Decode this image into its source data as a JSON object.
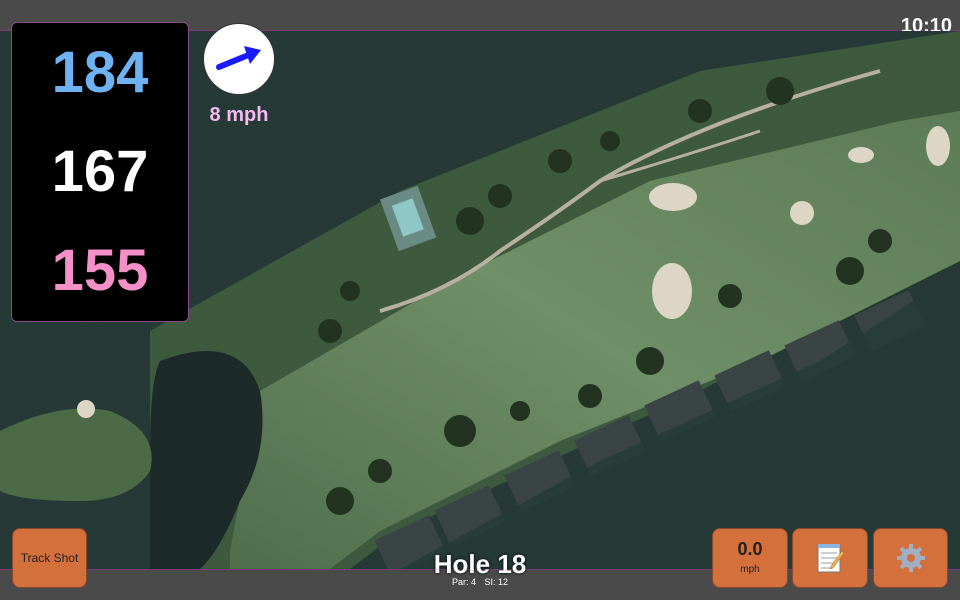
{
  "status": {
    "time": "10:10"
  },
  "yardages": {
    "back": "184",
    "middle": "167",
    "front": "155"
  },
  "wind": {
    "speed": "8 mph",
    "icon": "wind-direction-arrow-icon",
    "color": "#1a1aff"
  },
  "buttons": {
    "track_shot": "Track Shot",
    "speed_value": "0.0",
    "speed_unit": "mph",
    "notes_icon": "notepad-icon",
    "settings_icon": "gear-icon"
  },
  "hole": {
    "title": "Hole 18",
    "par": "Par: 4",
    "si": "SI: 12"
  },
  "colors": {
    "button": "#d4703c",
    "back_yardage": "#6fb2f2",
    "middle_yardage": "#ffffff",
    "front_yardage": "#f490c8",
    "wind_text": "#f8b8f0"
  }
}
